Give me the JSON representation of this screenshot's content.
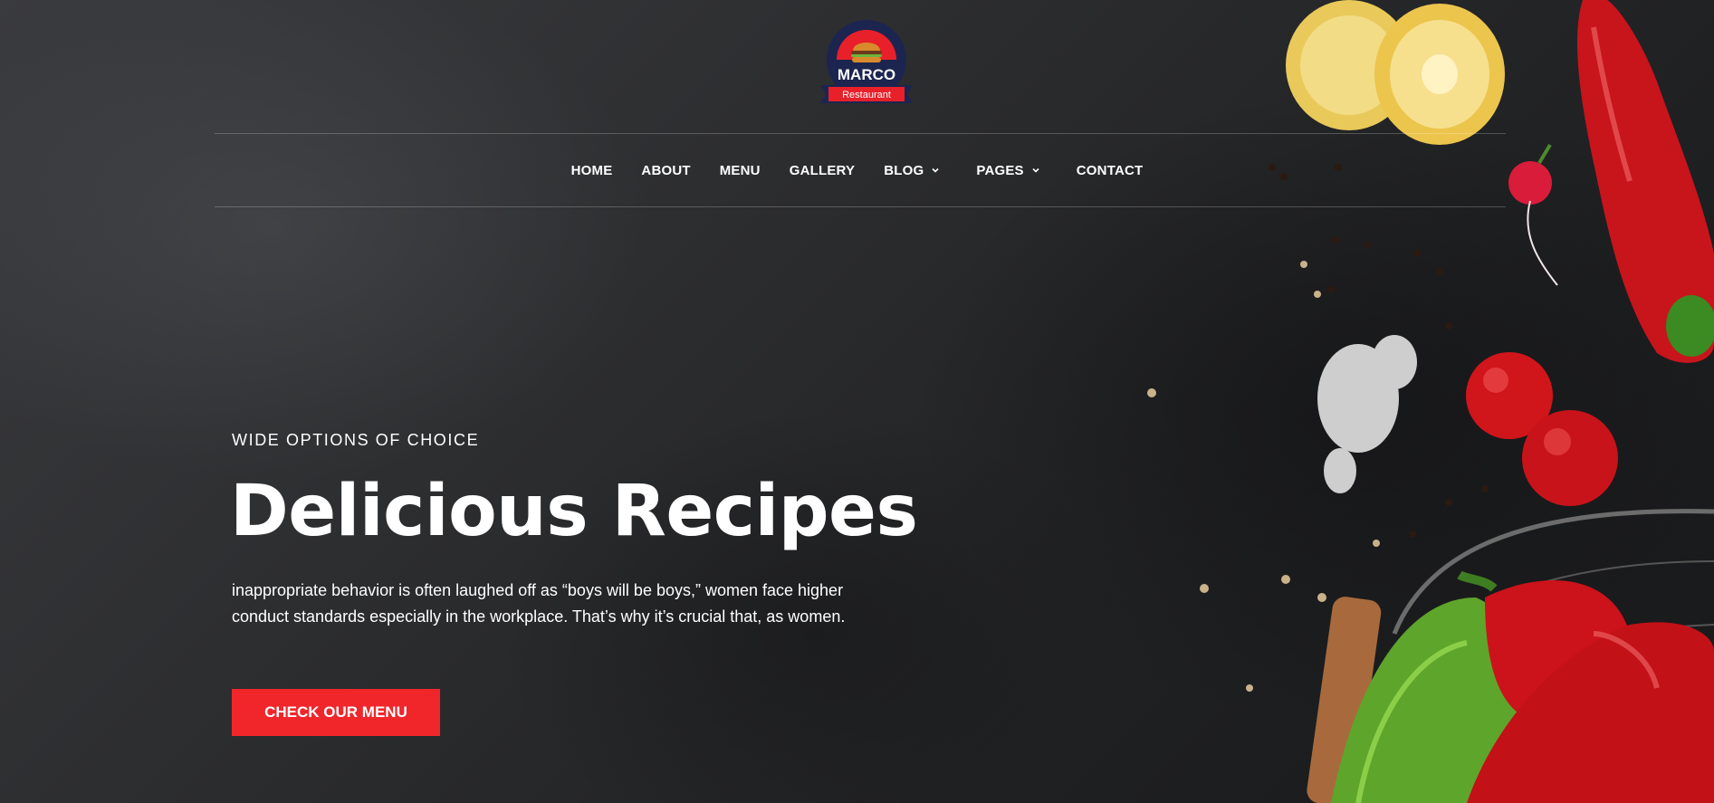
{
  "logo": {
    "name": "MARCO",
    "tagline": "Restaurant"
  },
  "nav": {
    "items": [
      {
        "label": "HOME",
        "dropdown": false
      },
      {
        "label": "ABOUT",
        "dropdown": false
      },
      {
        "label": "MENU",
        "dropdown": false
      },
      {
        "label": "GALLERY",
        "dropdown": false
      },
      {
        "label": "BLOG",
        "dropdown": true
      },
      {
        "label": "PAGES",
        "dropdown": true
      },
      {
        "label": "CONTACT",
        "dropdown": false
      }
    ]
  },
  "hero": {
    "eyebrow": "WIDE OPTIONS OF CHOICE",
    "title": "Delicious Recipes",
    "description": "inappropriate behavior is often laughed off as “boys will be boys,” women face higher conduct standards especially in the workplace. That’s why it’s crucial that, as women.",
    "cta_label": "CHECK OUR MENU"
  },
  "colors": {
    "accent": "#f0262a",
    "background": "#2b2c2e",
    "text": "#ffffff",
    "logo_navy": "#1c2550"
  },
  "icons": {
    "dropdown": "chevron-down-icon",
    "logo_image": "burger-icon"
  }
}
